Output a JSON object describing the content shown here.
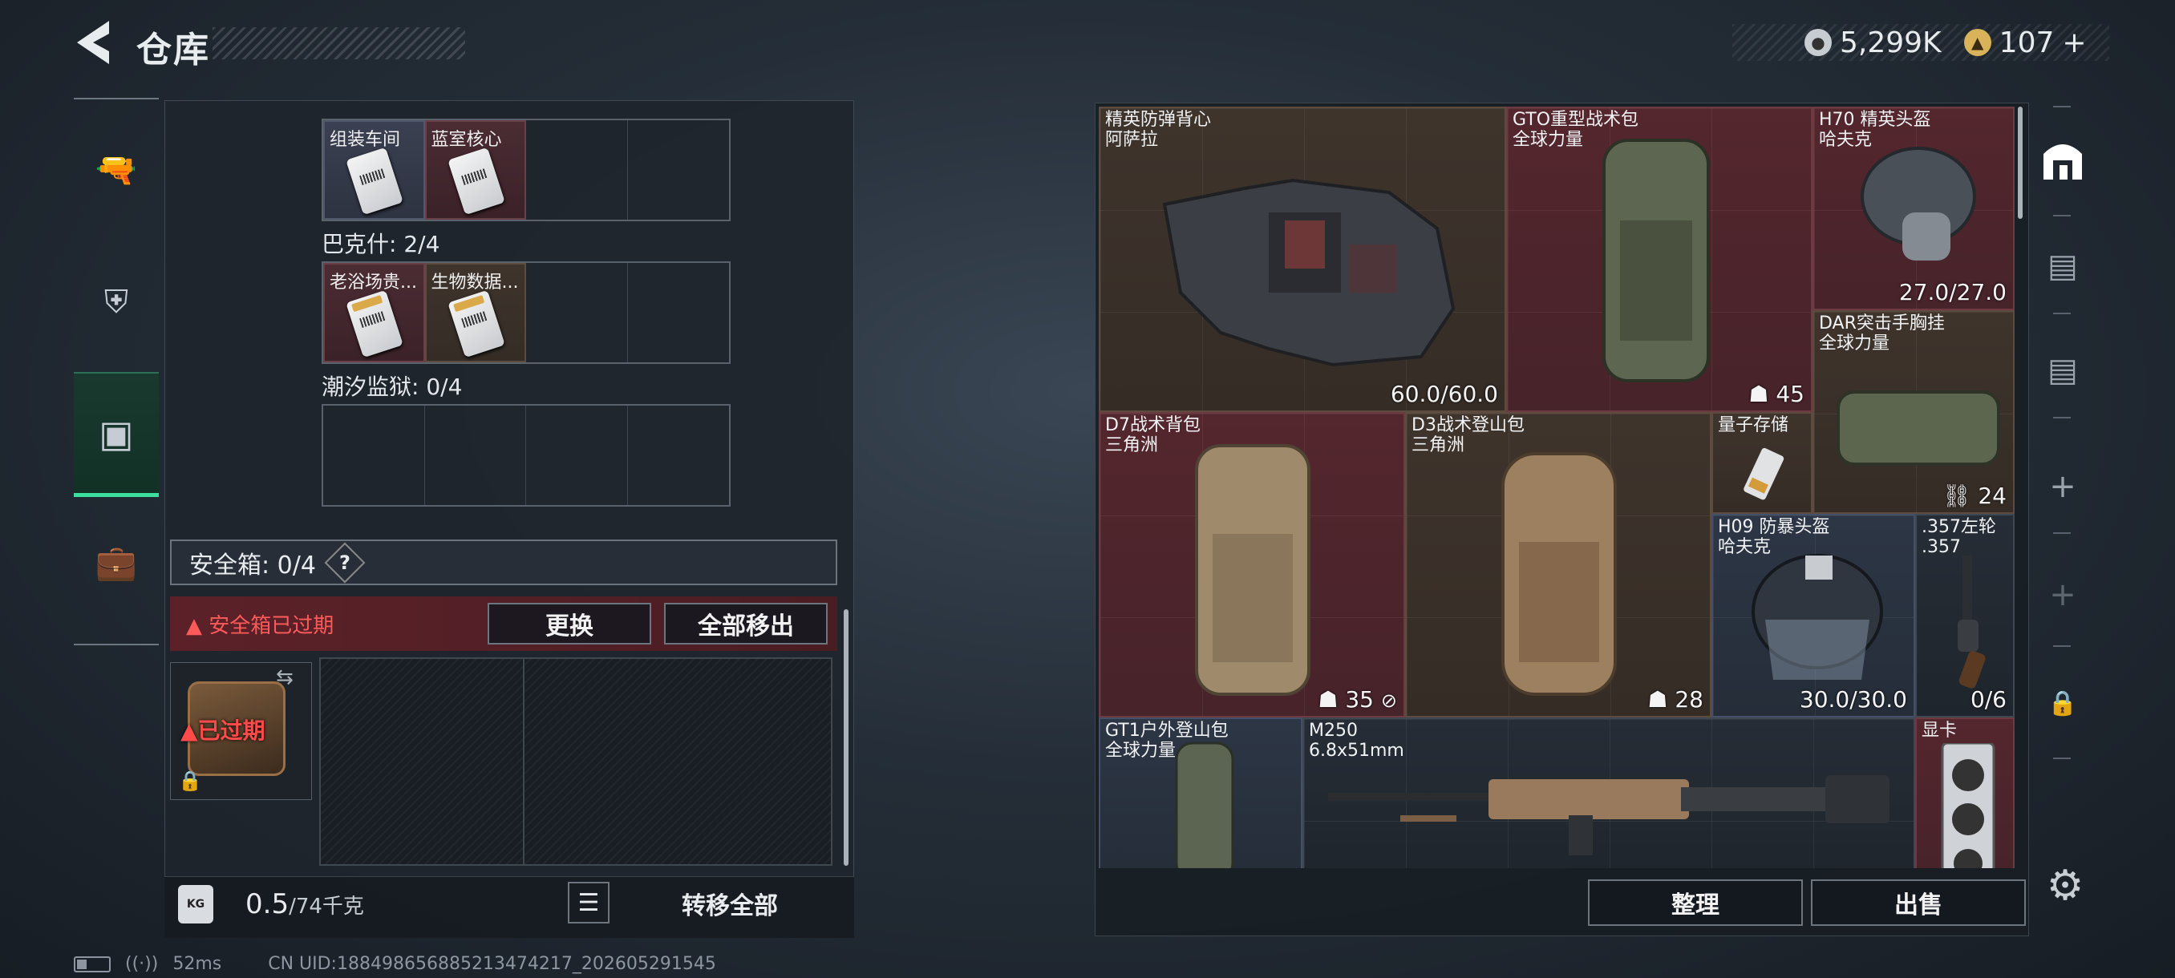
{
  "header": {
    "title": "仓库",
    "currency_main": "5,299K",
    "currency_premium": "107",
    "currency_plus": "+"
  },
  "left_tabs": [
    {
      "icon": "pistol-icon"
    },
    {
      "icon": "armor-icon"
    },
    {
      "icon": "backpack-icon",
      "active": true
    },
    {
      "icon": "toolbox-icon"
    }
  ],
  "keycards": {
    "row1": [
      "组装车间",
      "蓝室核心"
    ],
    "section2_title": "巴克什: 2/4",
    "row2": [
      "老浴场贵...",
      "生物数据..."
    ],
    "section3_title": "潮汐监狱: 0/4"
  },
  "safe": {
    "title": "安全箱: 0/4",
    "help": "?",
    "expired_msg": "安全箱已过期",
    "replace_label": "更换",
    "move_all_label": "全部移出",
    "expired_tag": "已过期"
  },
  "weight": {
    "icon_text": "KG",
    "value": "0.5",
    "unit": "/74千克",
    "transfer_all_label": "转移全部"
  },
  "status_bar": {
    "ping": "52ms",
    "uid": "CN UID:18849865688521347421​7_202605291545"
  },
  "stash_items": {
    "vest": {
      "name": "精英防弹背心",
      "sub": "阿萨拉",
      "stat": "60.0/60.0"
    },
    "gto": {
      "name": "GTO重型战术包",
      "sub": "全球力量",
      "stat": "45"
    },
    "h70": {
      "name": "H70 精英头盔",
      "sub": "哈夫克",
      "stat": "27.0/27.0"
    },
    "dar": {
      "name": "DAR突击手胸挂",
      "sub": "全球力量",
      "stat": "24"
    },
    "d7": {
      "name": "D7战术背包",
      "sub": "三角洲",
      "stat": "35"
    },
    "d3": {
      "name": "D3战术登山包",
      "sub": "三角洲",
      "stat": "28"
    },
    "quantum": {
      "name": "量子存储",
      "sub": ""
    },
    "h09": {
      "name": "H09 防暴头盔",
      "sub": "哈夫克",
      "stat": "30.0/30.0"
    },
    "revolver": {
      "name": ".357左轮",
      "sub": ".357",
      "stat": "0/6"
    },
    "gt1": {
      "name": "GT1户外登山包",
      "sub": "全球力量"
    },
    "m250": {
      "name": "M250",
      "sub": "6.8x51mm"
    },
    "gpu": {
      "name": "显卡",
      "sub": ""
    }
  },
  "actions": {
    "sort_label": "整理",
    "sell_label": "出售"
  }
}
